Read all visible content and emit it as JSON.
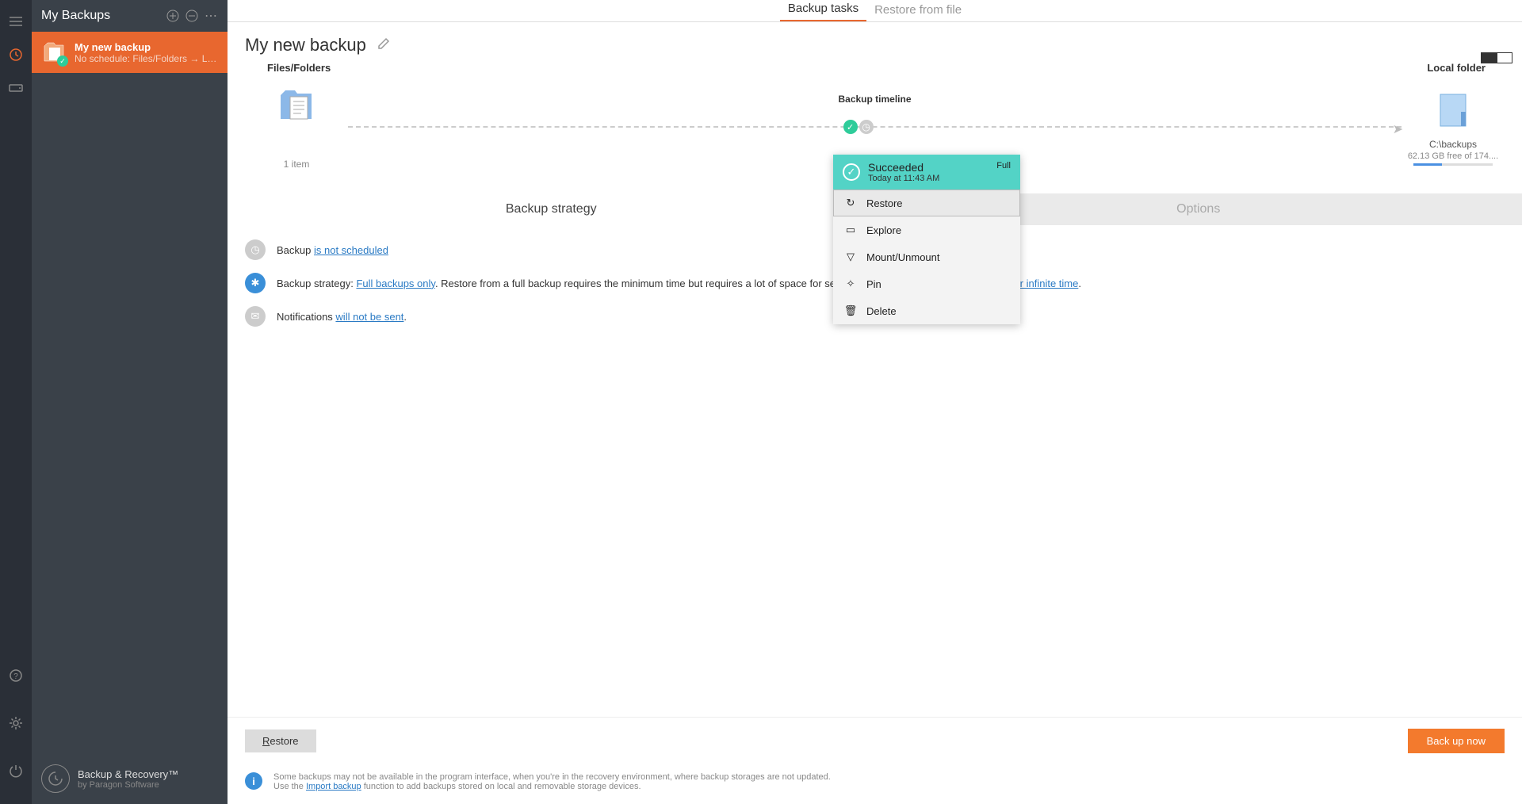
{
  "leftPanel": {
    "title": "My Backups",
    "item": {
      "title": "My new backup",
      "subtitle": "No schedule: Files/Folders → Loca..."
    },
    "product": "Backup & Recovery™",
    "company": "by Paragon Software"
  },
  "topTabs": {
    "backup": "Backup tasks",
    "restore": "Restore from file"
  },
  "page": {
    "title": "My new backup",
    "sourceLabel": "Files/Folders",
    "sourceCount": "1 item",
    "timelineLabel": "Backup timeline",
    "destLabel": "Local folder",
    "destPath": "C:\\backups",
    "destFree": "62.13 GB free of 174...."
  },
  "popup": {
    "status": "Succeeded",
    "time": "Today at 11:43 AM",
    "tag": "Full",
    "items": {
      "restore": "Restore",
      "explore": "Explore",
      "mount": "Mount/Unmount",
      "pin": "Pin",
      "delete": "Delete"
    }
  },
  "strategyTabs": {
    "strategy": "Backup strategy",
    "options": "Options"
  },
  "strategy": {
    "schedulePrefix": "Backup ",
    "scheduleLink": "is not scheduled",
    "strategyPrefix": "Backup strategy: ",
    "strategyLink": "Full backups only",
    "strategyMid": ". Restore from a full backup requires the minimum time but requires a lot of space for several restore points. Backups are ",
    "strategyLink2": "kept for infinite time",
    "strategySuffix": ".",
    "notifPrefix": "Notifications ",
    "notifLink": "will not be sent",
    "notifSuffix": "."
  },
  "buttons": {
    "restore": "Restore",
    "backup": "Back up now"
  },
  "footer": {
    "line1": "Some backups may not be available in the program interface, when you're in the recovery environment, where backup storages are not updated.",
    "line2a": "Use the ",
    "line2link": "Import backup",
    "line2b": " function to add backups stored on local and removable storage devices."
  }
}
